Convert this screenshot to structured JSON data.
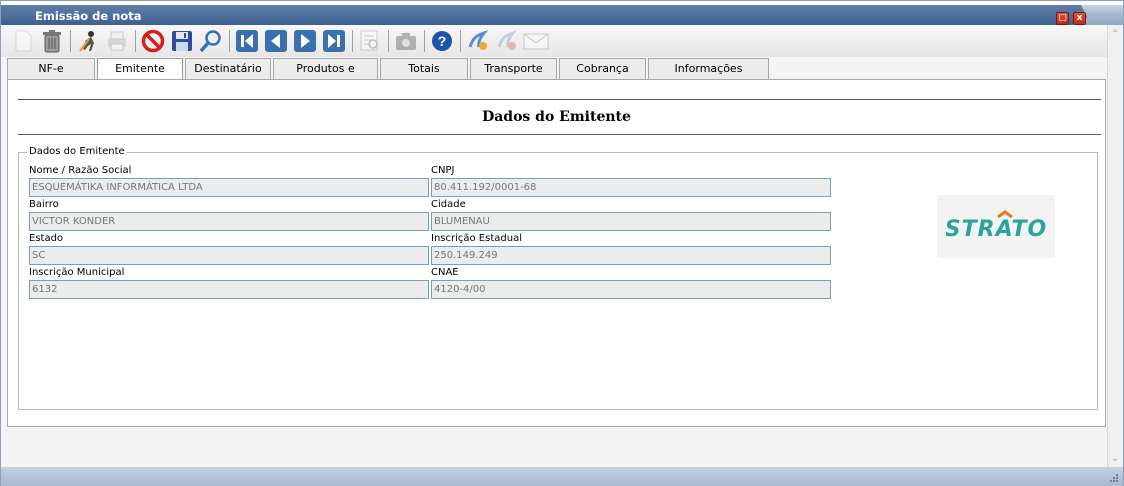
{
  "window": {
    "title": "Emissão de nota"
  },
  "tabs": [
    {
      "label": "NF-e"
    },
    {
      "label": "Emitente"
    },
    {
      "label": "Destinatário"
    },
    {
      "label": "Produtos e Serviços"
    },
    {
      "label": "Totais"
    },
    {
      "label": "Transporte"
    },
    {
      "label": "Cobrança"
    },
    {
      "label": "Informações Adicionais"
    }
  ],
  "active_tab": "Emitente",
  "section": {
    "title": "Dados do Emitente",
    "group_legend": "Dados do Emitente"
  },
  "fields": {
    "nome": {
      "label": "Nome / Razão Social",
      "value": "ESQUEMÁTIKA INFORMÁTICA LTDA"
    },
    "cnpj": {
      "label": "CNPJ",
      "value": "80.411.192/0001-68"
    },
    "bairro": {
      "label": "Bairro",
      "value": "VICTOR KONDER"
    },
    "cidade": {
      "label": "Cidade",
      "value": "BLUMENAU"
    },
    "estado": {
      "label": "Estado",
      "value": "SC"
    },
    "ie": {
      "label": "Inscrição Estadual",
      "value": "250.149.249"
    },
    "im": {
      "label": "Inscrição Municipal",
      "value": "6132"
    },
    "cnae": {
      "label": "CNAE",
      "value": "4120-4/00"
    }
  },
  "logo": {
    "text": "STRATO"
  },
  "toolbar": {
    "icons": [
      "new-icon",
      "trash-icon",
      "edit-icon",
      "print-icon",
      "cancel-icon",
      "save-icon",
      "search-icon",
      "first-icon",
      "previous-icon",
      "next-icon",
      "last-icon",
      "report-icon",
      "camera-icon",
      "help-icon",
      "sign-icon",
      "sign-disabled-icon",
      "email-icon"
    ]
  },
  "colors": {
    "title_bar": "#3e6090",
    "nav_blue": "#3a6fb0",
    "cancel_red": "#d42020",
    "logo_teal": "#2aa39a",
    "logo_orange": "#e87722"
  }
}
